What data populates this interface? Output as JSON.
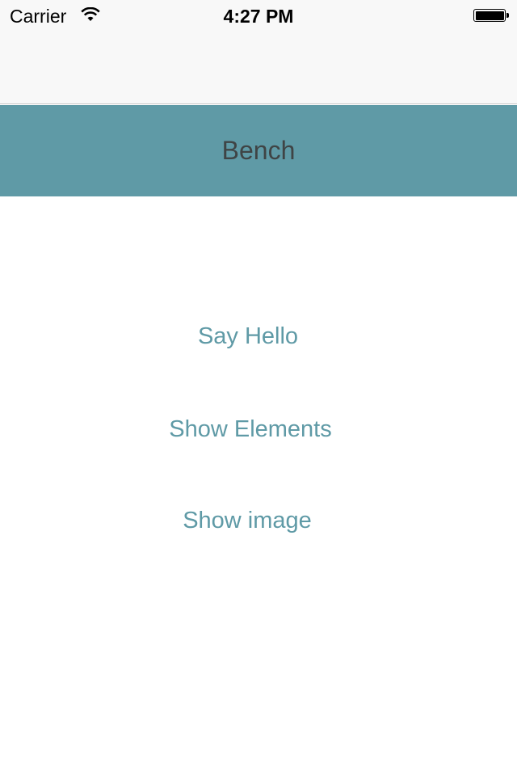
{
  "status_bar": {
    "carrier": "Carrier",
    "time": "4:27 PM",
    "icons": [
      "wifi-icon",
      "battery-icon"
    ]
  },
  "header": {
    "title": "Bench"
  },
  "buttons": [
    {
      "label": "Say Hello"
    },
    {
      "label": "Show Elements"
    },
    {
      "label": "Show image"
    }
  ],
  "colors": {
    "accent": "#5f9aa6",
    "header_text": "#3f4445",
    "nav_bg": "#f8f8f8"
  }
}
